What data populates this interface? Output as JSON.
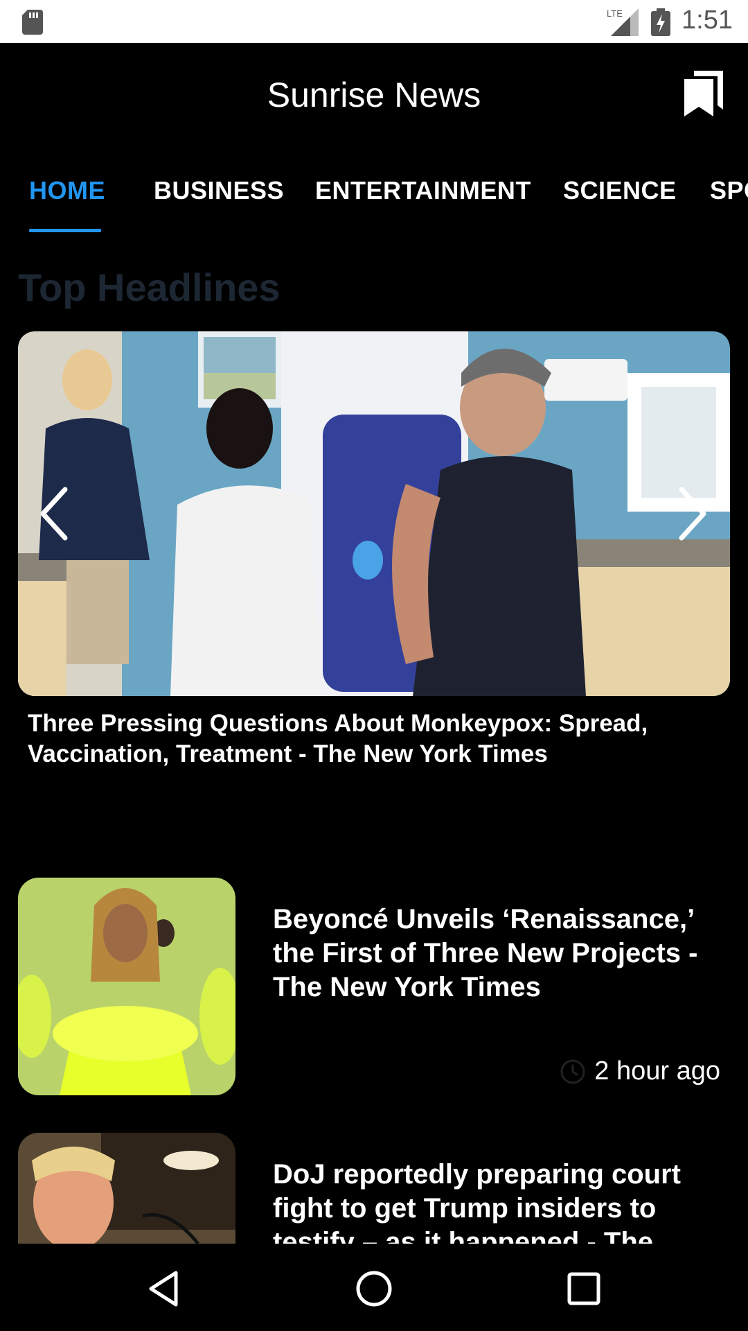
{
  "status_bar": {
    "network": "LTE",
    "time": "1:51",
    "icons": [
      "sd-card-icon",
      "lte-signal-icon",
      "battery-charging-icon"
    ]
  },
  "app_bar": {
    "title": "Sunrise News",
    "bookmark_icon": "bookmark-icon"
  },
  "tabs": [
    {
      "label": "HOME",
      "active": true
    },
    {
      "label": "BUSINESS",
      "active": false
    },
    {
      "label": "ENTERTAINMENT",
      "active": false
    },
    {
      "label": "SCIENCE",
      "active": false
    },
    {
      "label": "SPORTS",
      "active": false
    }
  ],
  "top_headlines": {
    "title": "Top Headlines",
    "carousel": {
      "headline": "Three Pressing Questions About Monkeypox: Spread, Vaccination, Treatment - The New York Times",
      "prev_icon": "chevron-left-icon",
      "next_icon": "chevron-right-icon"
    }
  },
  "news_list": [
    {
      "headline": "Beyoncé Unveils ‘Renaissance,’ the First of Three New Projects - The New York Times",
      "time": "2 hour ago"
    },
    {
      "headline": "DoJ reportedly preparing court fight to get Trump insiders to testify – as it happened - The Guardian"
    }
  ],
  "nav_bar": {
    "back_icon": "back-triangle-icon",
    "home_icon": "home-circle-icon",
    "recents_icon": "recents-square-icon"
  },
  "colors": {
    "accent": "#2196f3",
    "background": "#000000",
    "section_title": "#1d2733"
  }
}
